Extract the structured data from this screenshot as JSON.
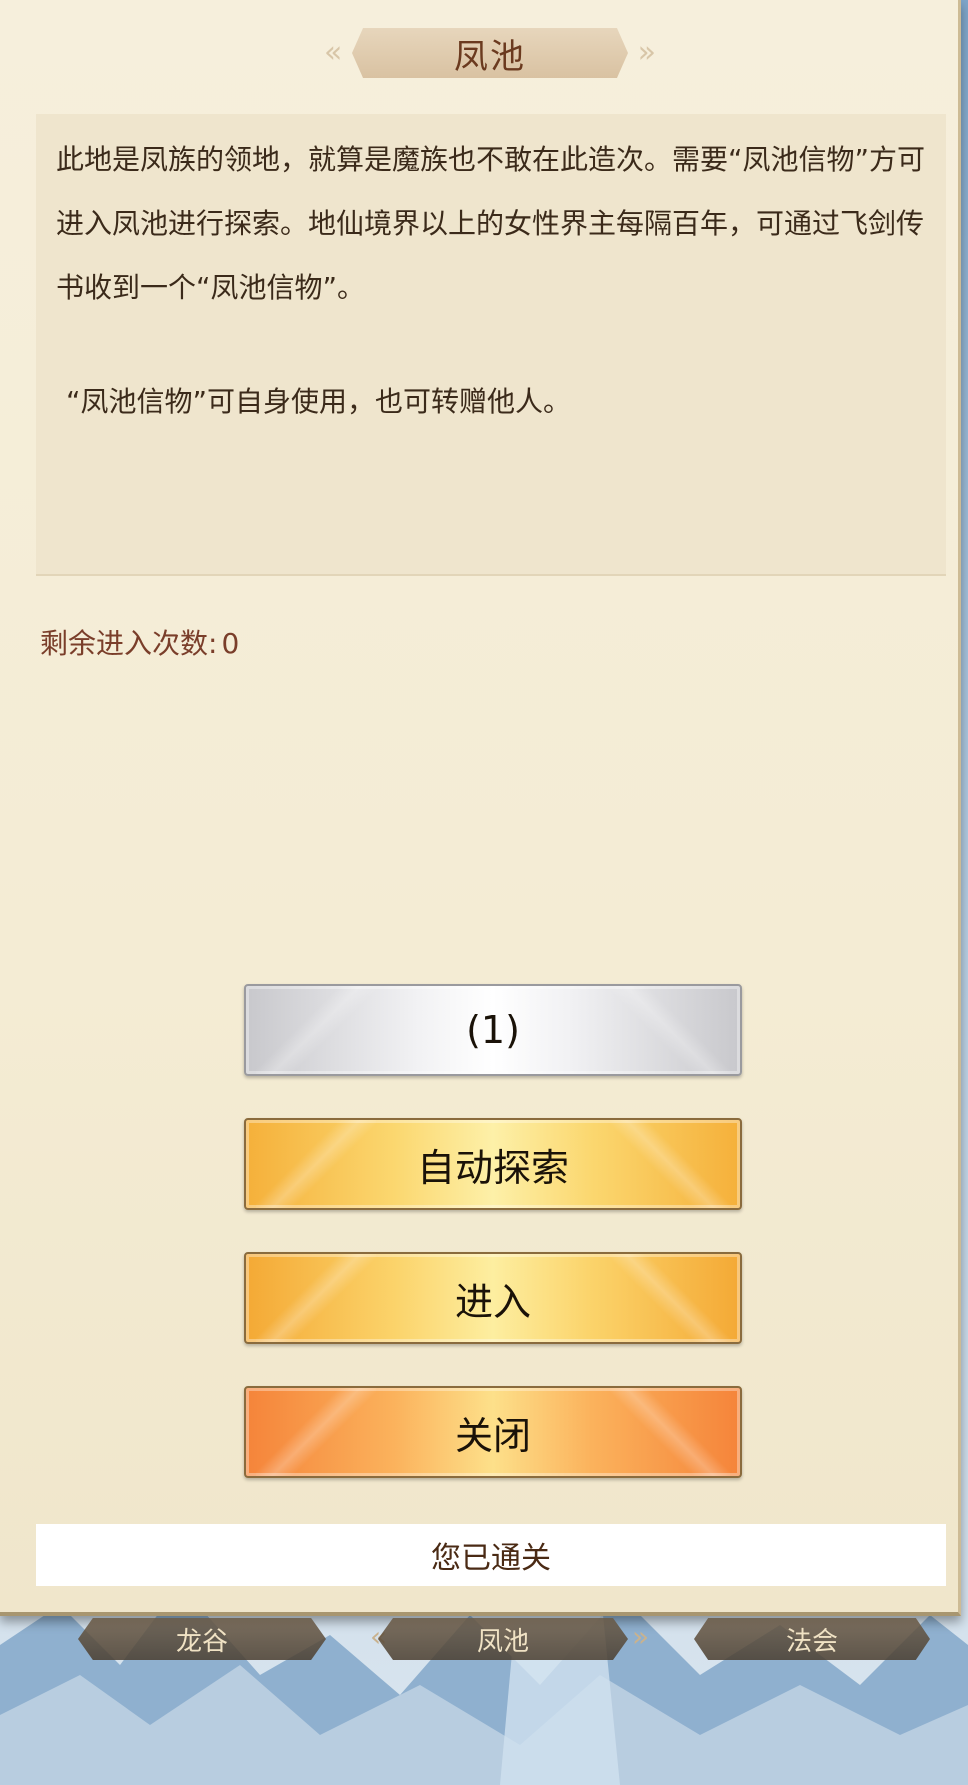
{
  "dialog": {
    "title": "凤池",
    "description_p1": "此地是凤族的领地，就算是魔族也不敢在此造次。需要“凤池信物”方可进入凤池进行探索。地仙境界以上的女性界主每隔百年，可通过飞剑传书收到一个“凤池信物”。",
    "description_p2": "“凤池信物”可自身使用，也可转赠他人。",
    "remaining_label": "剩余进入次数:",
    "remaining_value": "0"
  },
  "buttons": {
    "count_label": "(1)",
    "auto_explore_label": "自动探索",
    "enter_label": "进入",
    "close_label": "关闭"
  },
  "status": {
    "cleared_text": "您已通关"
  },
  "tabs": [
    {
      "label": "龙谷"
    },
    {
      "label": "凤池"
    },
    {
      "label": "法会"
    }
  ],
  "colors": {
    "panel_bg": "#f4ecd4",
    "title_text": "#6b3a1f",
    "remaining_text": "#7a3e2a",
    "gold_button": "#fbd76f",
    "orange_button": "#f5843a"
  }
}
